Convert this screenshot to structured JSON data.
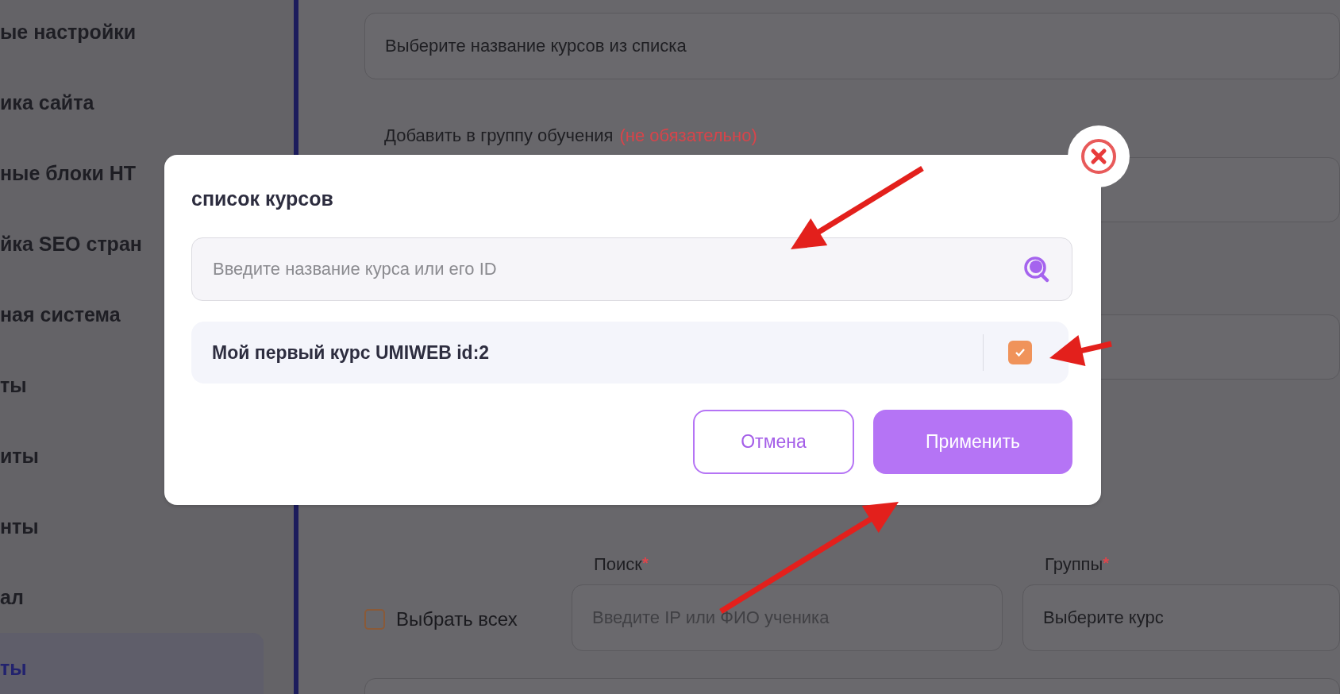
{
  "sidebar": {
    "items": [
      {
        "label": "ые настройки",
        "selected": false
      },
      {
        "label": "ика сайта",
        "selected": false
      },
      {
        "label": "ные блоки HT",
        "selected": false
      },
      {
        "label": "йка SEO стран",
        "selected": false
      },
      {
        "label": "ная система",
        "selected": false
      },
      {
        "label": "ты",
        "selected": false
      },
      {
        "label": "иты",
        "selected": false
      },
      {
        "label": "нты",
        "selected": false
      },
      {
        "label": "ал",
        "selected": false
      },
      {
        "label": "ты",
        "selected": true
      }
    ]
  },
  "form": {
    "courses_field": {
      "value": "Выберите название курсов из списка"
    },
    "group_label": {
      "text": "Добавить в группу обучения",
      "note": "(не обязательно)"
    },
    "select_all": {
      "label": "Выбрать всех",
      "checked": false
    },
    "search": {
      "label": "Поиск",
      "required_mark": "*",
      "placeholder": "Введите IP или ФИО ученика"
    },
    "groups": {
      "label": "Группы",
      "required_mark": "*",
      "value": "Выберите курс"
    }
  },
  "modal": {
    "title": "список курсов",
    "search": {
      "placeholder": "Введите название курса или его ID"
    },
    "courses": [
      {
        "name": "Мой первый курс UMIWEB id:2",
        "checked": true
      }
    ],
    "buttons": [
      {
        "label": "Отмена",
        "kind": "secondary"
      },
      {
        "label": "Применить",
        "kind": "primary"
      }
    ]
  }
}
